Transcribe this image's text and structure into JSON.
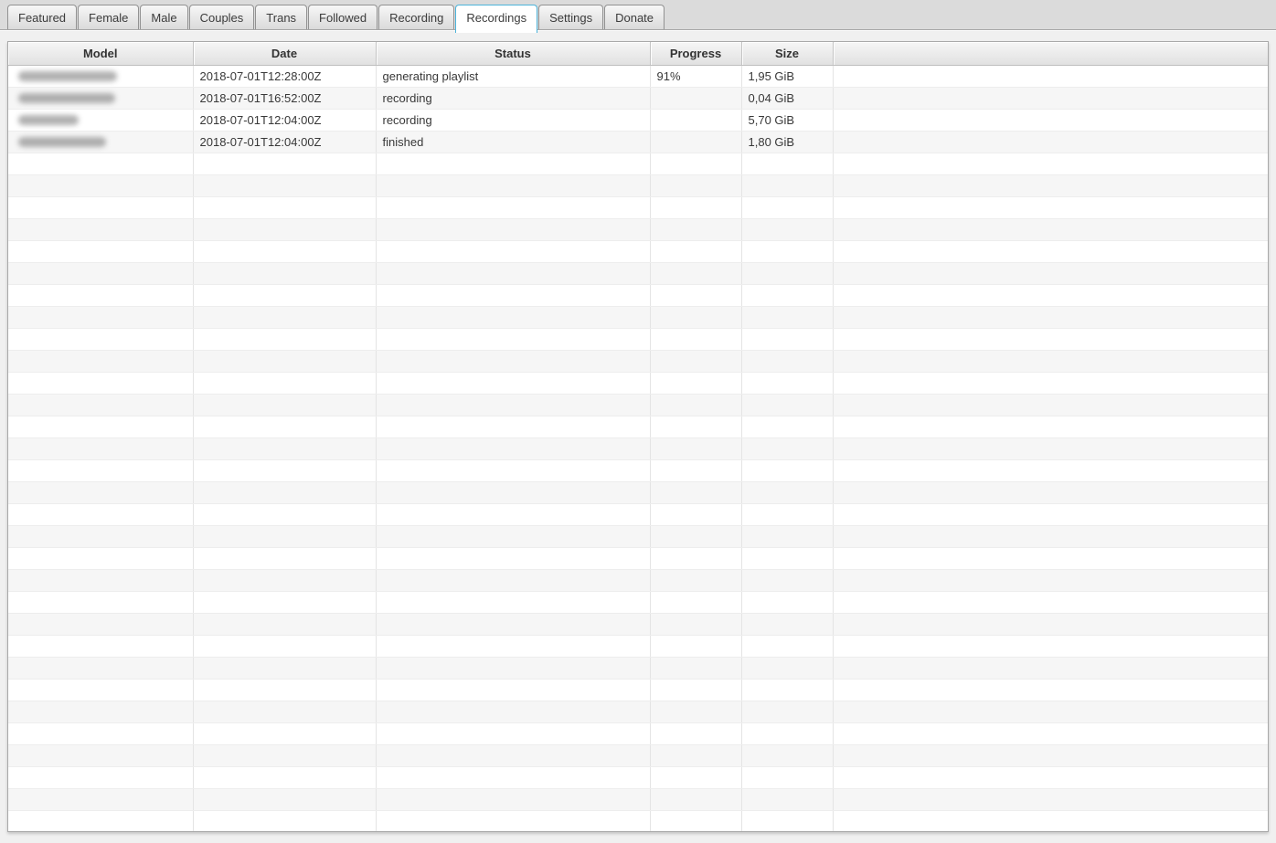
{
  "tabs": [
    {
      "id": "featured",
      "label": "Featured",
      "active": false
    },
    {
      "id": "female",
      "label": "Female",
      "active": false
    },
    {
      "id": "male",
      "label": "Male",
      "active": false
    },
    {
      "id": "couples",
      "label": "Couples",
      "active": false
    },
    {
      "id": "trans",
      "label": "Trans",
      "active": false
    },
    {
      "id": "followed",
      "label": "Followed",
      "active": false
    },
    {
      "id": "recording",
      "label": "Recording",
      "active": false
    },
    {
      "id": "recordings",
      "label": "Recordings",
      "active": true
    },
    {
      "id": "settings",
      "label": "Settings",
      "active": false
    },
    {
      "id": "donate",
      "label": "Donate",
      "active": false
    }
  ],
  "colors": {
    "active_tab_border": "#4cb3da",
    "tab_bar_background": "#dbdbdb",
    "row_stripe": "#f6f6f6",
    "page_background": "#f0f0f0"
  },
  "table": {
    "columns": [
      {
        "id": "model",
        "label": "Model"
      },
      {
        "id": "date",
        "label": "Date"
      },
      {
        "id": "status",
        "label": "Status"
      },
      {
        "id": "progress",
        "label": "Progress"
      },
      {
        "id": "size",
        "label": "Size"
      },
      {
        "id": "spacer",
        "label": ""
      }
    ],
    "rows": [
      {
        "model": {
          "redacted": true,
          "blur_width": 108
        },
        "date": "2018-07-01T12:28:00Z",
        "status": "generating playlist",
        "progress": "91%",
        "size": "1,95 GiB"
      },
      {
        "model": {
          "redacted": true,
          "blur_width": 106
        },
        "date": "2018-07-01T16:52:00Z",
        "status": "recording",
        "progress": "",
        "size": "0,04 GiB"
      },
      {
        "model": {
          "redacted": true,
          "blur_width": 66
        },
        "date": "2018-07-01T12:04:00Z",
        "status": "recording",
        "progress": "",
        "size": "5,70 GiB"
      },
      {
        "model": {
          "redacted": true,
          "blur_width": 96
        },
        "date": "2018-07-01T12:04:00Z",
        "status": "finished",
        "progress": "",
        "size": "1,80 GiB"
      }
    ],
    "empty_row_count": 31
  }
}
